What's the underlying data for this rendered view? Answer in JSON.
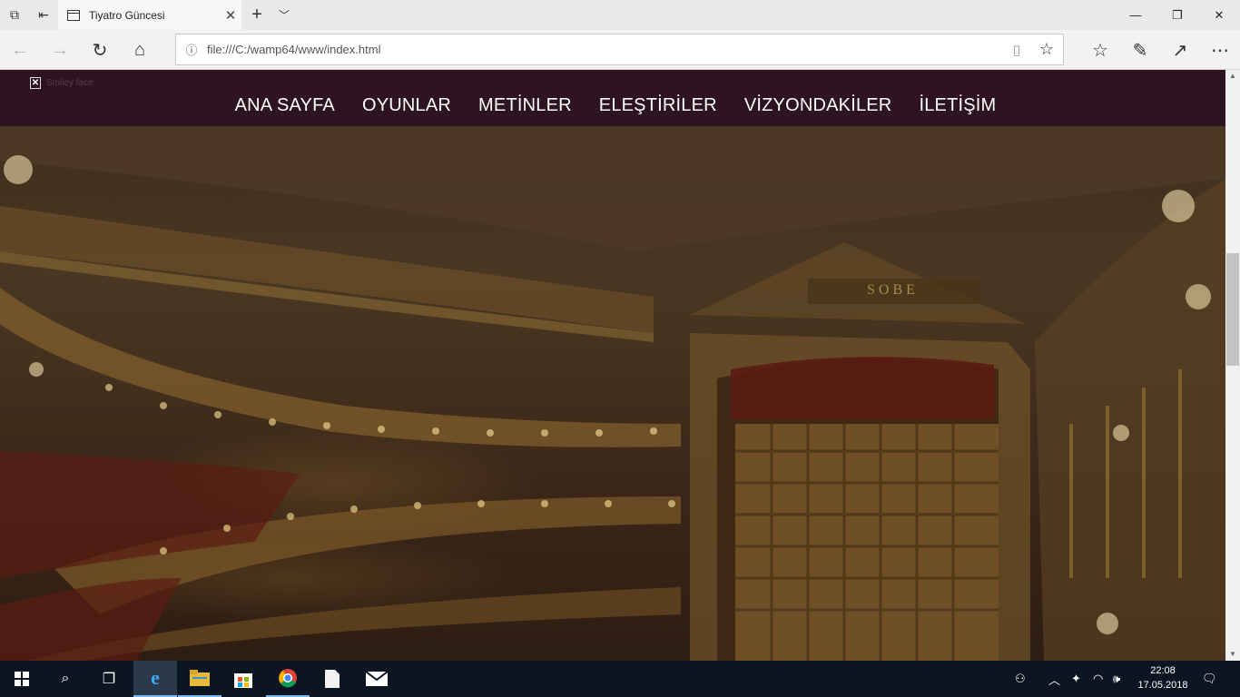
{
  "browser": {
    "tab_title": "Tiyatro Güncesi",
    "url": "file:///C:/wamp64/www/index.html"
  },
  "page": {
    "broken_image_alt": "Smiley face",
    "menu": [
      "ANA SAYFA",
      "OYUNLAR",
      "METİNLER",
      "ELEŞTİRİLER",
      "VİZYONDAKİLER",
      "İLETİŞİM"
    ],
    "hero_caption": "S O B E"
  },
  "taskbar": {
    "time": "22:08",
    "date": "17.05.2018"
  },
  "colors": {
    "header_bg": "#2d1420",
    "menu_text": "#ffffff",
    "taskbar_bg": "#0b1622",
    "accent": "#76b9ed"
  }
}
